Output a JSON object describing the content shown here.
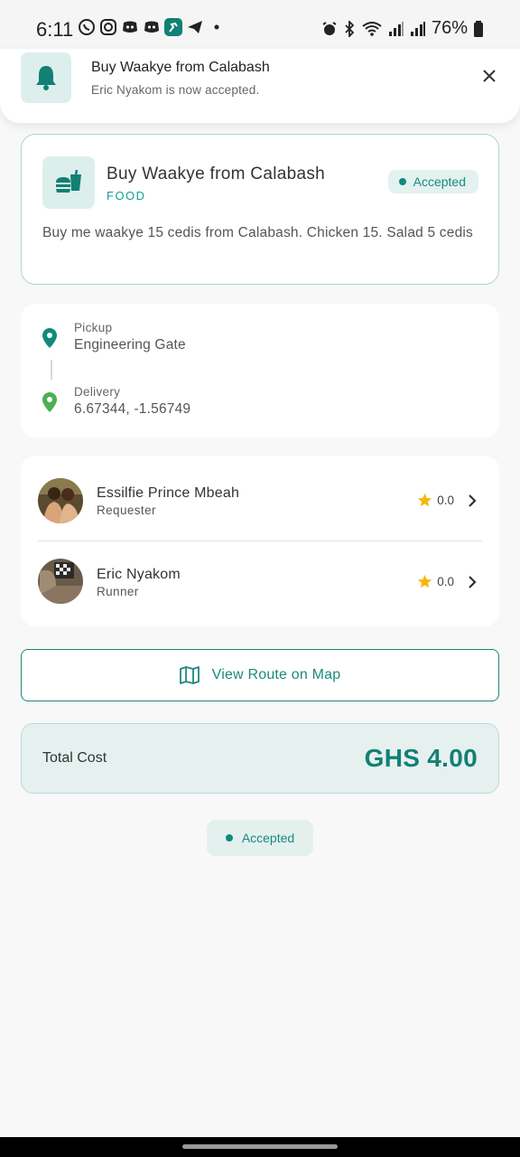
{
  "status_bar": {
    "time": "6:11",
    "battery": "76%"
  },
  "notification": {
    "title": "Buy Waakye from Calabash",
    "message": "Eric Nyakom is now accepted."
  },
  "request": {
    "title": "Buy Waakye from Calabash",
    "category": "FOOD",
    "status": "Accepted",
    "description": "Buy me waakye 15 cedis from Calabash. Chicken 15. Salad 5 cedis"
  },
  "locations": {
    "pickup_label": "Pickup",
    "pickup_value": "Engineering Gate",
    "delivery_label": "Delivery",
    "delivery_value": "6.67344, -1.56749"
  },
  "people": [
    {
      "name": "Essilfie Prince Mbeah",
      "role": "Requester",
      "rating": "0.0"
    },
    {
      "name": "Eric Nyakom",
      "role": "Runner",
      "rating": "0.0"
    }
  ],
  "route_button_label": "View Route on Map",
  "total": {
    "label": "Total Cost",
    "value": "GHS 4.00"
  },
  "status_pill": "Accepted",
  "colors": {
    "accent": "#128075",
    "accent_light": "#e3f0ee",
    "pin_pickup": "#0f8b7e",
    "pin_delivery": "#4caf50",
    "star": "#f5b70c"
  }
}
